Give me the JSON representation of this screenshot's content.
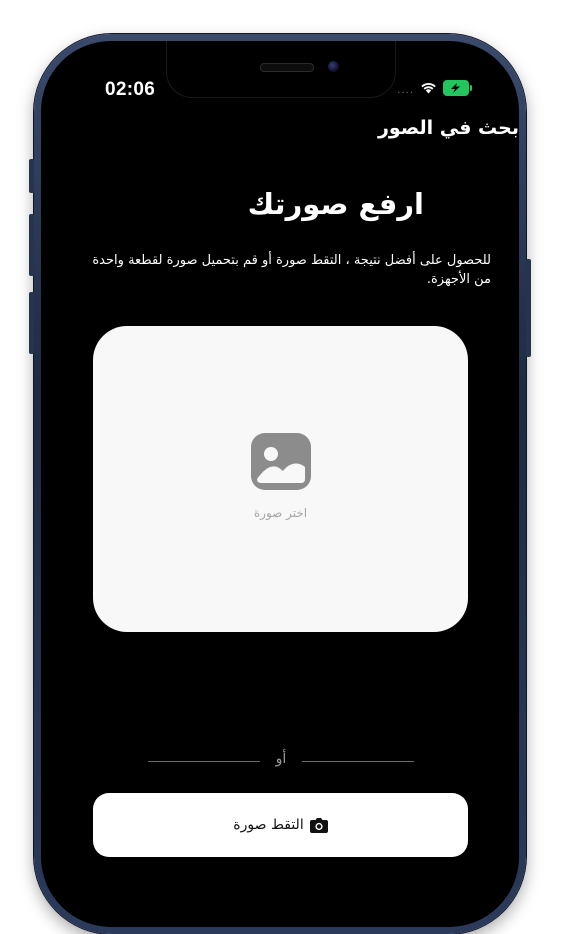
{
  "status_bar": {
    "time": "02:06",
    "signal_dots": "....",
    "wifi_icon": "wifi-icon",
    "battery_icon": "battery-charging-icon",
    "battery_color": "#22c55e"
  },
  "nav": {
    "title": "بحث في الصور"
  },
  "main": {
    "heading": "ارفع صورتك",
    "description": "للحصول على أفضل نتيجة ، التقط صورة أو قم بتحميل صورة لقطعة واحدة من الأجهزة.",
    "upload_card": {
      "icon": "image-icon",
      "label": "اختر صورة"
    },
    "divider_text": "أو",
    "camera_button": {
      "icon": "camera-icon",
      "label": "التقط صورة"
    }
  },
  "colors": {
    "screen_background": "#000000",
    "card_background": "#f8f8f8",
    "muted_text": "#a6a6a6"
  }
}
